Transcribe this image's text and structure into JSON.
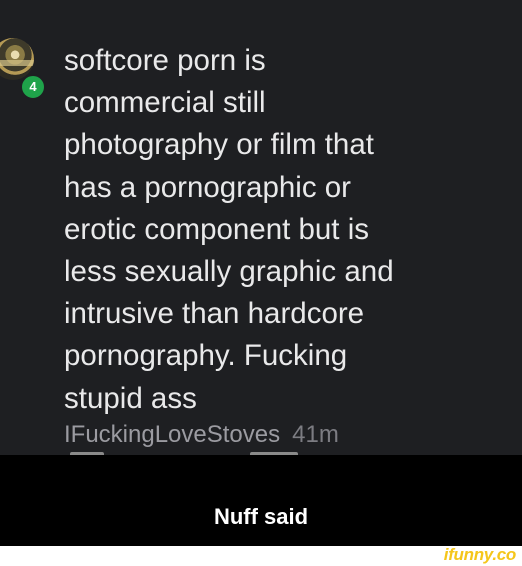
{
  "comment": {
    "text": "softcore porn is\ncommercial still\nphotography or film that\nhas a pornographic or\nerotic component but is\nless sexually graphic and\nintrusive than hardcore\npornography. Fucking\nstupid ass",
    "username": "IFuckingLoveStoves",
    "timestamp": "41m",
    "level_badge": "4",
    "avatar_icon": "user-avatar-icon"
  },
  "caption": "Nuff said",
  "watermark": "ifunny.co",
  "colors": {
    "comment_background": "#1e1f22",
    "text": "#e9e9ea",
    "username": "#9b9ba1",
    "badge": "#1fa34a",
    "watermark": "#f5c61b"
  }
}
